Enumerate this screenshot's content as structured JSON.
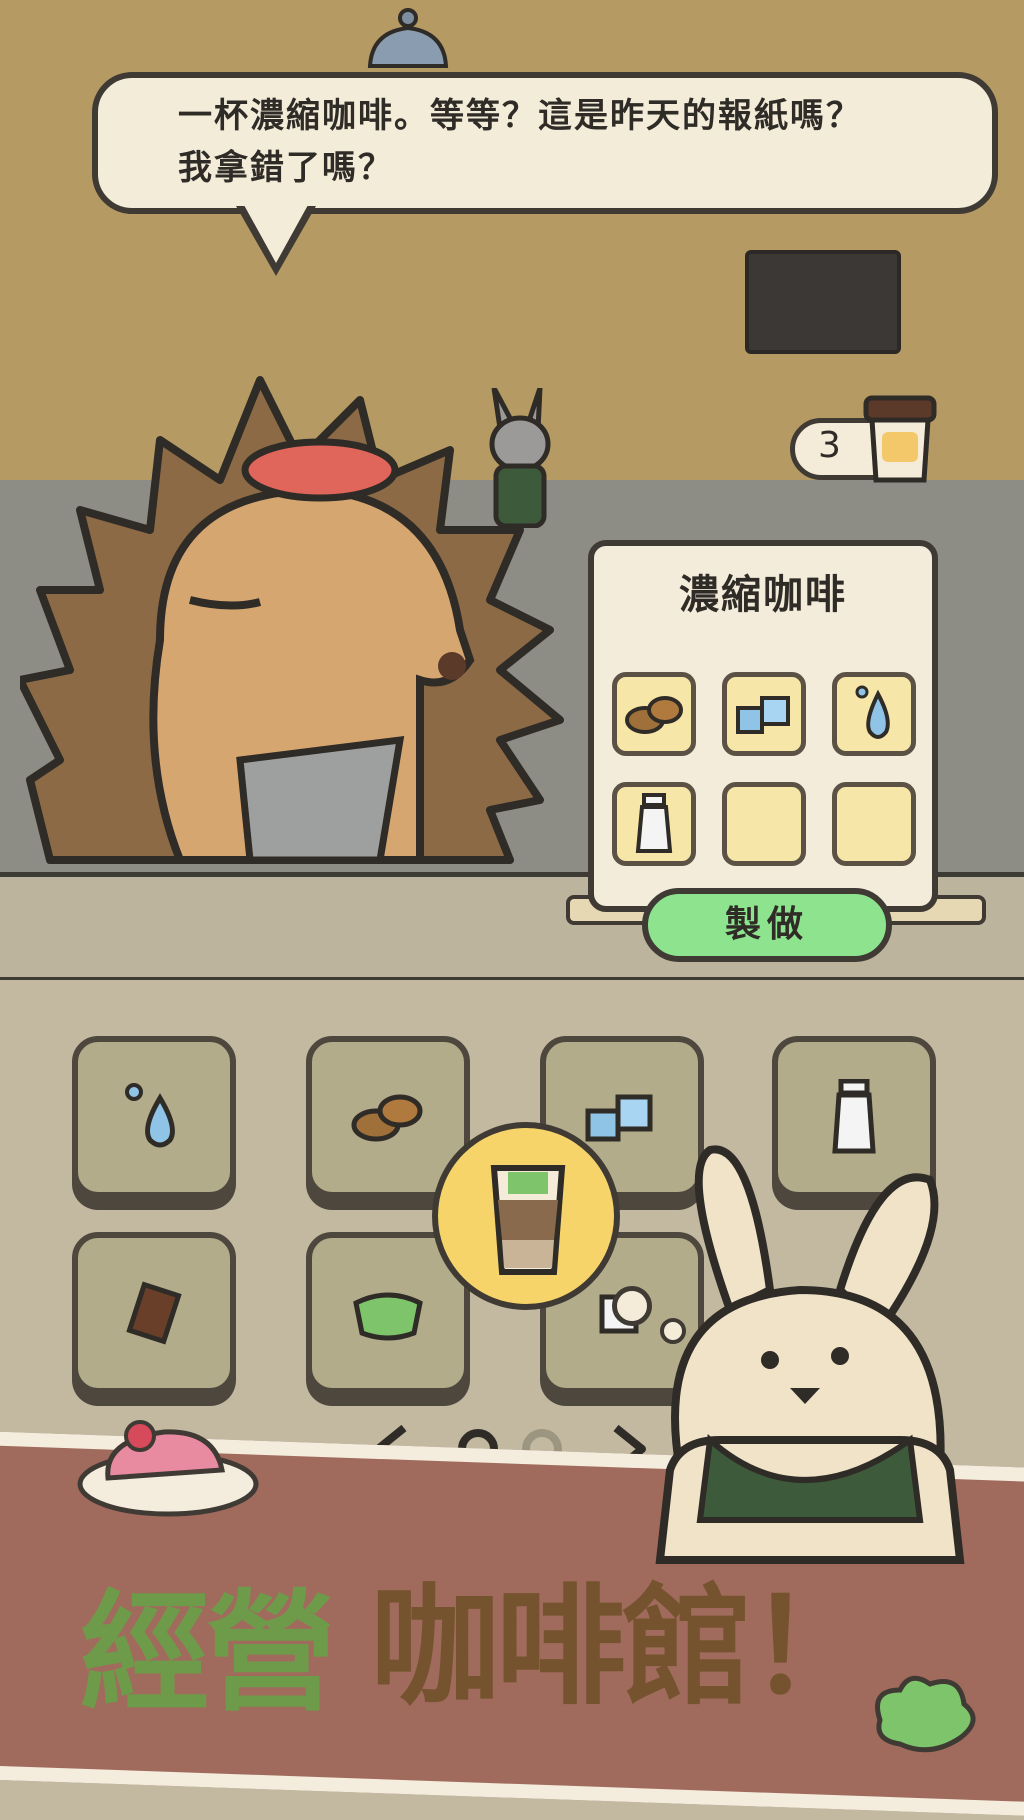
{
  "dialogue": {
    "line1": "一杯濃縮咖啡。等等？這是昨天的報紙嗎？",
    "line2": "我拿錯了嗎？"
  },
  "order_counter": {
    "value": "3",
    "icon": "coffee-cup-icon"
  },
  "recipe": {
    "title": "濃縮咖啡",
    "slots": [
      "coffee-beans-icon",
      "ice-cubes-icon",
      "water-drop-icon",
      "milk-bottle-icon",
      "",
      ""
    ],
    "make_label": "製做"
  },
  "ingredients": [
    "water-drop-icon",
    "coffee-beans-icon",
    "ice-cubes-icon",
    "milk-bottle-icon",
    "chocolate-icon",
    "matcha-bowl-icon",
    "sugar-icon"
  ],
  "pager": {
    "pages": 2,
    "current": 1
  },
  "banner": {
    "title_green": "經營",
    "title_brown": "咖啡館！"
  },
  "colors": {
    "accent_green": "#8ee48e",
    "title_green": "#6e9b4a",
    "title_brown": "#75532f",
    "banner": "#a06b5c"
  }
}
